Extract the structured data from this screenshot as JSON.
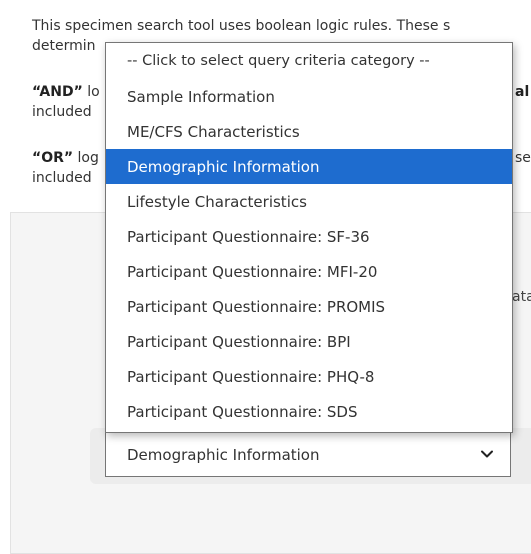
{
  "intro": {
    "line1": "This specimen search tool uses boolean logic rules. These s",
    "line2": "determin",
    "and_label": "“AND”",
    "and_rest": " lo",
    "and_tail": "al",
    "and_line2": "included",
    "or_label": "“OR”",
    "or_rest": " log",
    "or_tail": "se",
    "or_line2": "included"
  },
  "panel": {
    "partial_text": "ata"
  },
  "category_select": {
    "selected_value": "Demographic Information",
    "options": [
      "-- Click to select query criteria category --",
      "Sample Information",
      "ME/CFS Characteristics",
      "Demographic Information",
      "Lifestyle Characteristics",
      "Participant Questionnaire: SF-36",
      "Participant Questionnaire: MFI-20",
      "Participant Questionnaire: PROMIS",
      "Participant Questionnaire: BPI",
      "Participant Questionnaire: PHQ-8",
      "Participant Questionnaire: SDS"
    ],
    "highlighted_index": 3
  },
  "colors": {
    "highlight": "#1e6ccf",
    "panel_bg": "#f5f5f5"
  }
}
